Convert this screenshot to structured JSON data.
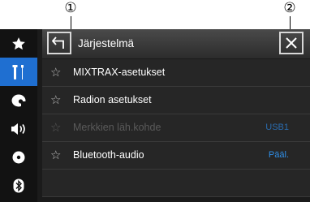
{
  "callouts": [
    "①",
    "②"
  ],
  "header": {
    "title": "Järjestelmä",
    "back_icon": "back-arrow-icon",
    "close_icon": "close-icon"
  },
  "sidebar": {
    "items": [
      {
        "icon": "star-icon",
        "active": false
      },
      {
        "icon": "settings-tools-icon",
        "active": true
      },
      {
        "icon": "theme-icon",
        "active": false
      },
      {
        "icon": "audio-icon",
        "active": false
      },
      {
        "icon": "disc-icon",
        "active": false
      },
      {
        "icon": "bluetooth-icon",
        "active": false
      }
    ]
  },
  "menu": {
    "star_glyph": "☆",
    "items": [
      {
        "label": "MIXTRAX-asetukset",
        "value": "",
        "enabled": true
      },
      {
        "label": "Radion asetukset",
        "value": "",
        "enabled": true
      },
      {
        "label": "Merkkien läh.kohde",
        "value": "USB1",
        "enabled": false
      },
      {
        "label": "Bluetooth-audio",
        "value": "Pääl.",
        "enabled": true
      }
    ]
  },
  "colors": {
    "accent": "#1f6fd1",
    "value_text": "#2f8fe8",
    "background": "#1b1b1b"
  }
}
